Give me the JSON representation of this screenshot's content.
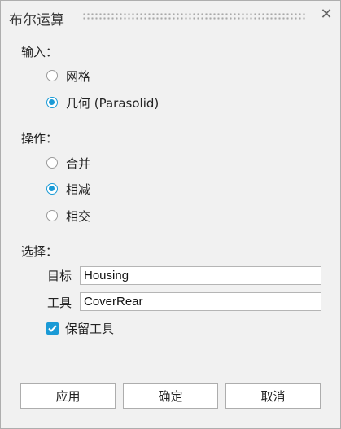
{
  "dialog": {
    "title": "布尔运算"
  },
  "input": {
    "label": "输入：",
    "options": [
      {
        "label": "网格",
        "selected": false
      },
      {
        "label": "几何 (Parasolid)",
        "selected": true
      }
    ]
  },
  "operation": {
    "label": "操作：",
    "options": [
      {
        "label": "合并",
        "selected": false
      },
      {
        "label": "相减",
        "selected": true
      },
      {
        "label": "相交",
        "selected": false
      }
    ]
  },
  "selection": {
    "label": "选择：",
    "target_label": "目标",
    "target_value": "Housing",
    "tool_label": "工具",
    "tool_value": "CoverRear",
    "keep_tool_label": "保留工具",
    "keep_tool_checked": true
  },
  "buttons": {
    "apply": "应用",
    "ok": "确定",
    "cancel": "取消"
  },
  "colors": {
    "accent": "#1a9ad6",
    "panel_bg": "#f1f1f1"
  }
}
